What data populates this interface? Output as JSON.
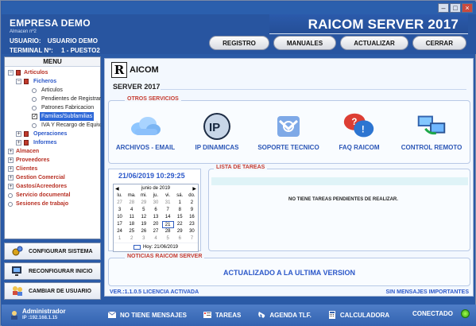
{
  "window": {
    "minimize": "–",
    "maximize": "□",
    "close": "×"
  },
  "header": {
    "company": "EMPRESA DEMO",
    "company_sub": "Almacen nº2",
    "user_label": "USUARIO:",
    "user_value": "USUARIO DEMO",
    "terminal_label": "TERMINAL Nº:",
    "terminal_value": "1   - PUESTO2",
    "app_title": "RAICOM SERVER 2017"
  },
  "toolbar": {
    "registro": "REGISTRO",
    "manuales": "MANUALES",
    "actualizar": "ACTUALIZAR",
    "cerrar": "CERRAR"
  },
  "menu": {
    "title": "MENU",
    "articulos": "Articulos",
    "ficheros": "Ficheros",
    "f1": "Articulos",
    "f2": "Pendientes de Registrar",
    "f3": "Patrones Fabricacion",
    "f4": "Familias/Subfamilias",
    "f5": "IVA Y Recargo de Equiv.",
    "operaciones": "Operaciones",
    "informes": "Informes",
    "almacen": "Almacen",
    "proveedores": "Proveedores",
    "clientes": "Clientes",
    "gestion_comercial": "Gestion Comercial",
    "gastos": "Gastos/Acreedores",
    "servicio_documental": "Servicio documental",
    "sesiones": "Sesiones de trabajo"
  },
  "side_buttons": {
    "configurar": "CONFIGURAR SISTEMA",
    "reconfigurar": "RECONFIGURAR INICIO",
    "cambiar": "CAMBIAR DE USUARIO"
  },
  "main": {
    "logo_letter": "R",
    "logo_text": "AICOM",
    "server_year": "SERVER 2017",
    "otros_title": "OTROS SERVICIOS",
    "services": [
      "ARCHIVOS - EMAIL",
      "IP DINAMICAS",
      "SOPORTE TECNICO",
      "FAQ RAICOM",
      "CONTROL REMOTO"
    ],
    "ip_icon_text": "IP",
    "datetime": "21/06/2019 10:29:25",
    "tasks_title": "LISTA DE TAREAS",
    "no_tasks": "NO TIENE TAREAS PENDIENTES DE REALIZAR.",
    "news_title": "NOTICIAS RAICOM SERVER",
    "news_text": "ACTUALIZADO A LA ULTIMA VERSION",
    "version": "VER.:1.1.0.5   LICENCIA ACTIVADA",
    "messages_link": "SIN MENSAJES IMPORTANTES"
  },
  "calendar": {
    "prev": "◀",
    "next": "▶",
    "month": "junio de 2019",
    "weekdays": [
      "lu.",
      "ma.",
      "mi.",
      "ju.",
      "vi.",
      "sá.",
      "do."
    ],
    "days": [
      [
        "27",
        "28",
        "29",
        "30",
        "31",
        "1",
        "2"
      ],
      [
        "3",
        "4",
        "5",
        "6",
        "7",
        "8",
        "9"
      ],
      [
        "10",
        "11",
        "12",
        "13",
        "14",
        "15",
        "16"
      ],
      [
        "17",
        "18",
        "19",
        "20",
        "21",
        "22",
        "23"
      ],
      [
        "24",
        "25",
        "26",
        "27",
        "28",
        "29",
        "30"
      ],
      [
        "1",
        "2",
        "3",
        "4",
        "5",
        "6",
        "7"
      ]
    ],
    "today": "Hoy: 21/06/2019"
  },
  "status": {
    "user": "Administrador",
    "ip": "IP :192.168.1.15",
    "messages": "NO TIENE MENSAJES",
    "tasks": "TAREAS",
    "agenda": "AGENDA TLF.",
    "calc": "CALCULADORA",
    "connected": "CONECTADO"
  }
}
